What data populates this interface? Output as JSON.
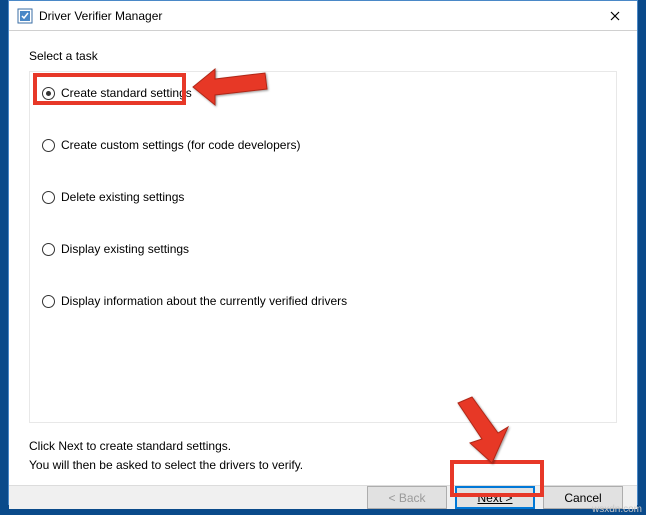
{
  "window": {
    "title": "Driver Verifier Manager"
  },
  "task_label": "Select a task",
  "options": {
    "opt0": "Create standard settings",
    "opt1": "Create custom settings (for code developers)",
    "opt2": "Delete existing settings",
    "opt3": "Display existing settings",
    "opt4": "Display information about the currently verified drivers"
  },
  "hint": {
    "line1": "Click Next to create standard settings.",
    "line2": "You will then be asked to select the drivers to verify."
  },
  "buttons": {
    "back": "< Back",
    "next": "Next >",
    "cancel": "Cancel"
  },
  "watermark": "wsxdn.com",
  "colors": {
    "highlight": "#e73828",
    "primary_border": "#0078d7"
  }
}
